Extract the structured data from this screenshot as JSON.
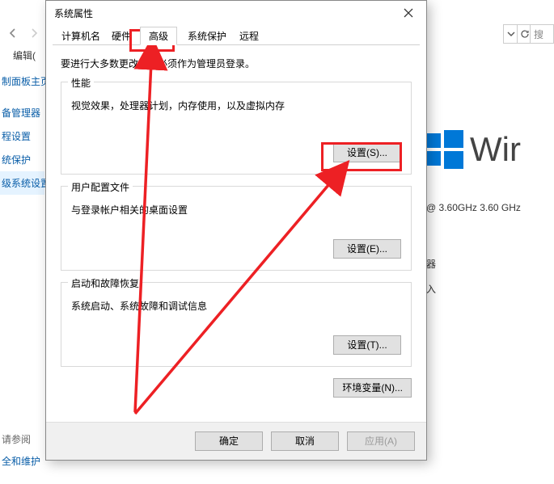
{
  "dialog": {
    "title": "系统属性",
    "tabs": {
      "computer_name": "计算机名",
      "hardware": "硬件",
      "advanced": "高级",
      "system_protection": "系统保护",
      "remote": "远程"
    },
    "lead": "要进行大多数更改，你必须作为管理员登录。",
    "perf": {
      "title": "性能",
      "desc": "视觉效果，处理器计划，内存使用，以及虚拟内存",
      "button": "设置(S)..."
    },
    "profiles": {
      "title": "用户配置文件",
      "desc": "与登录帐户相关的桌面设置",
      "button": "设置(E)..."
    },
    "startup": {
      "title": "启动和故障恢复",
      "desc": "系统启动、系统故障和调试信息",
      "button": "设置(T)..."
    },
    "envvar_button": "环境变量(N)...",
    "actions": {
      "ok": "确定",
      "cancel": "取消",
      "apply": "应用(A)"
    }
  },
  "background": {
    "toolbar_edit": "编辑(",
    "search_placeholder": "搜",
    "sidebar": {
      "item0": "制面板主页",
      "item1": "备管理器",
      "item2": "程设置",
      "item3": "统保护",
      "item4": "级系统设置"
    },
    "win_text": "Wir",
    "cpu_line": "@ 3.60GHz   3.60 GHz",
    "info_line1": "器",
    "info_line2": "入",
    "bottom": {
      "help": "请参阅",
      "security": "全和维护"
    }
  }
}
